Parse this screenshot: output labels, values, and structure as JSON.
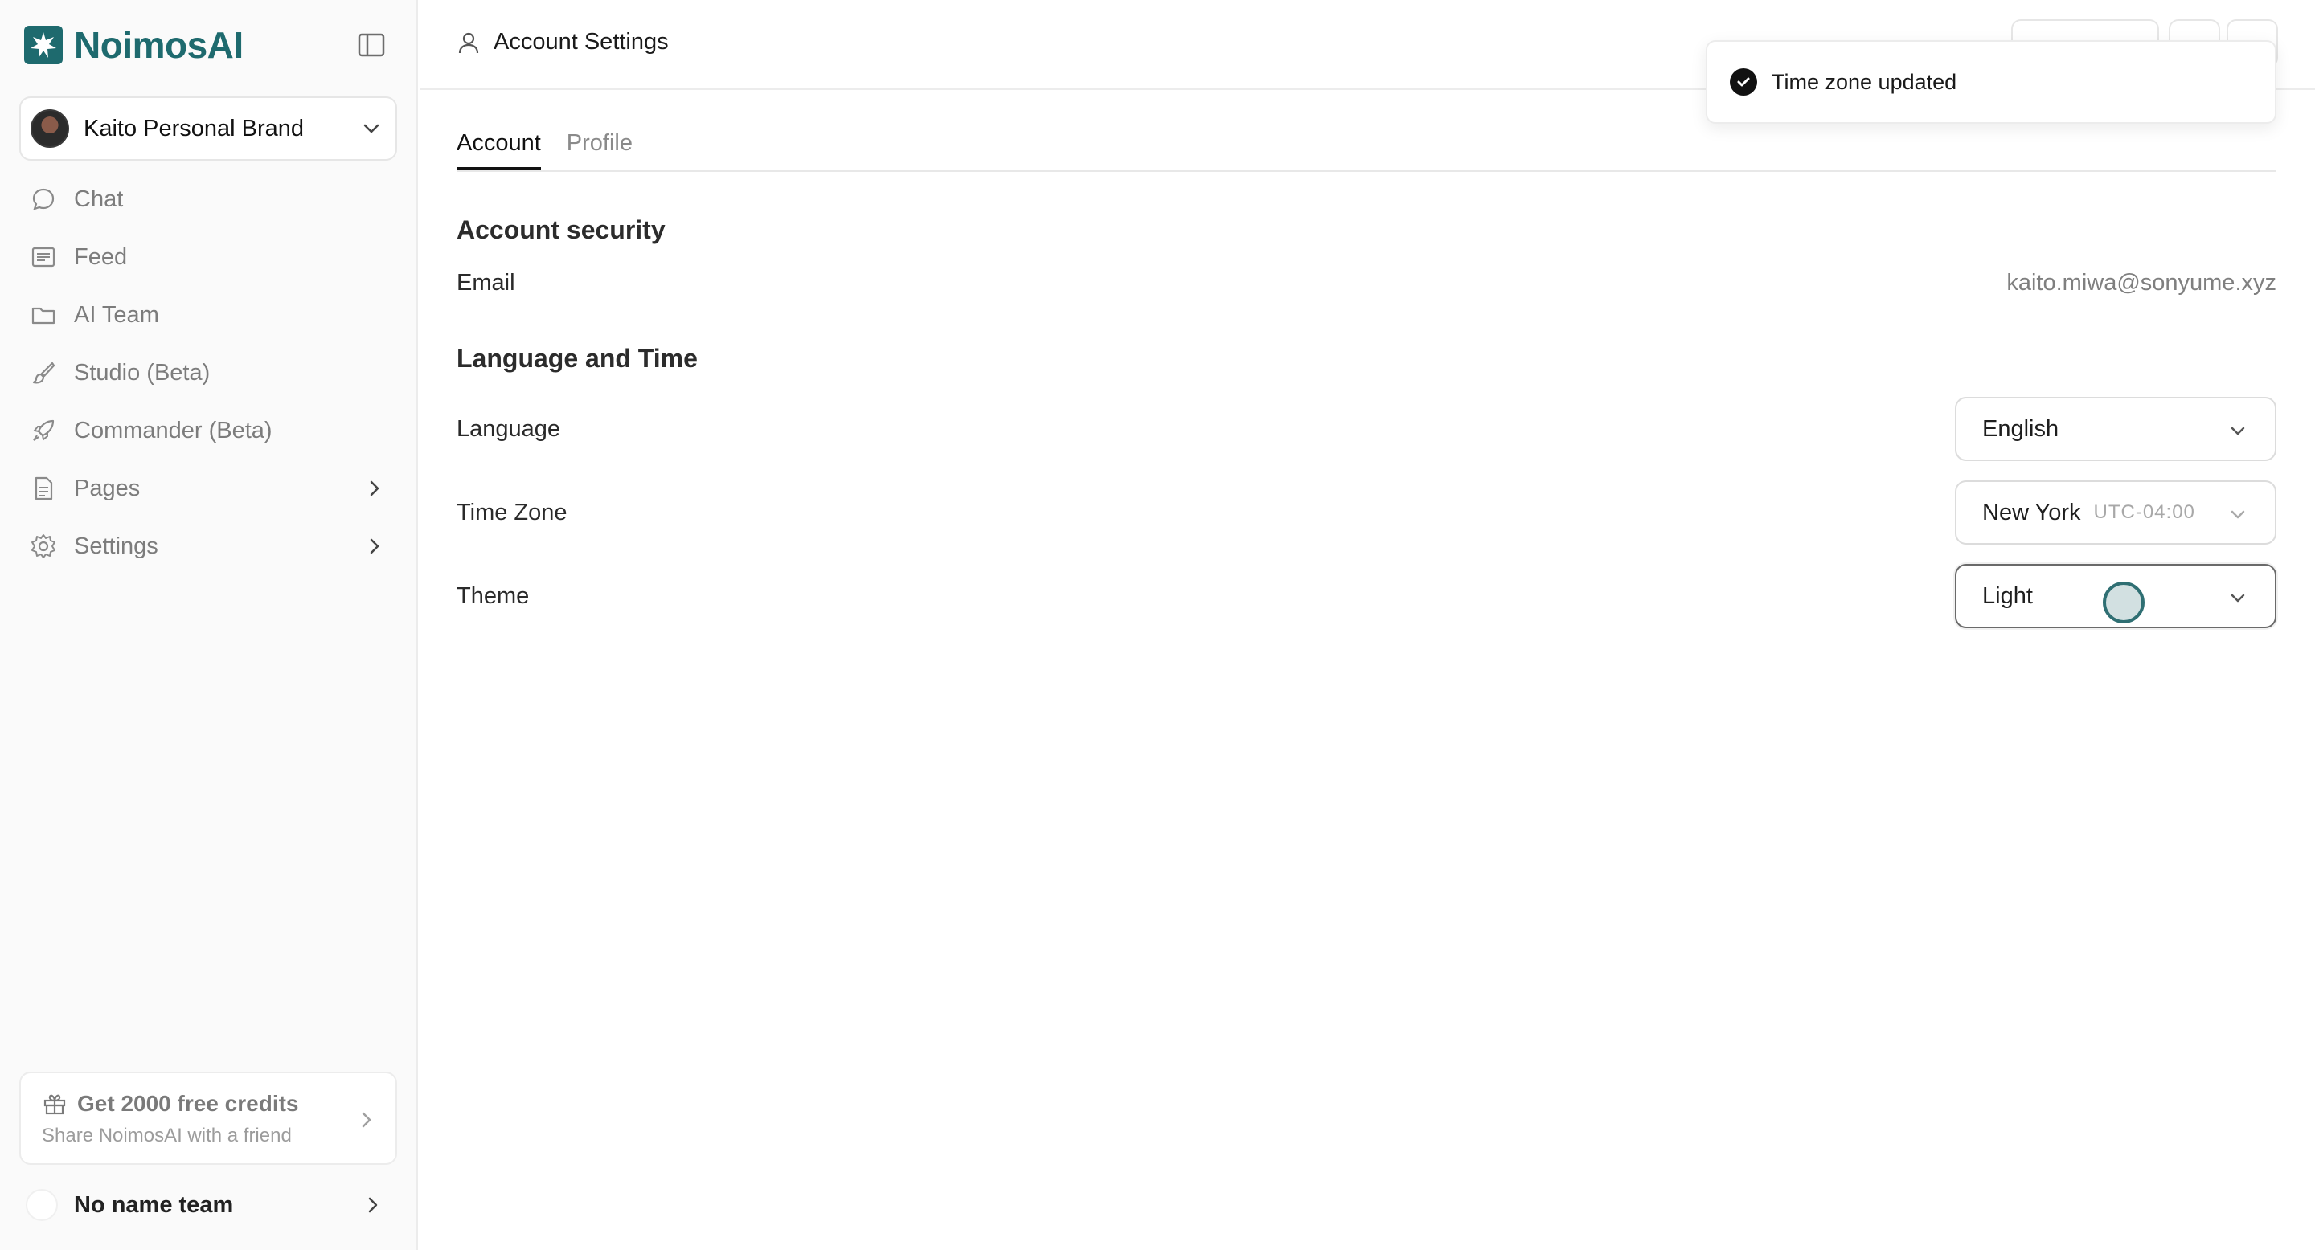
{
  "brand": {
    "name": "NoimosAI"
  },
  "workspace": {
    "name": "Kaito Personal Brand"
  },
  "nav": {
    "items": [
      {
        "label": "Chat",
        "icon": "chat-bubble-icon"
      },
      {
        "label": "Feed",
        "icon": "feed-list-icon"
      },
      {
        "label": "AI Team",
        "icon": "folder-icon"
      },
      {
        "label": "Studio (Beta)",
        "icon": "brush-icon"
      },
      {
        "label": "Commander (Beta)",
        "icon": "rocket-icon"
      },
      {
        "label": "Pages",
        "icon": "pages-icon"
      },
      {
        "label": "Settings",
        "icon": "gear-icon"
      }
    ]
  },
  "promo": {
    "title": "Get 2000 free credits",
    "subtitle": "Share NoimosAI with a friend"
  },
  "team": {
    "name": "No name team"
  },
  "header": {
    "title": "Account Settings"
  },
  "tabs": [
    {
      "label": "Account"
    },
    {
      "label": "Profile"
    }
  ],
  "account_security": {
    "heading": "Account security",
    "email_label": "Email",
    "email_value": "kaito.miwa@sonyume.xyz"
  },
  "language_time": {
    "heading": "Language and Time",
    "language_label": "Language",
    "language_value": "English",
    "timezone_label": "Time Zone",
    "timezone_value": "New York",
    "timezone_offset": "UTC-04:00",
    "theme_label": "Theme",
    "theme_value": "Light"
  },
  "toast": {
    "message": "Time zone updated"
  },
  "colors": {
    "brand": "#1e6a6e",
    "muted_text": "#7c7c7c"
  }
}
